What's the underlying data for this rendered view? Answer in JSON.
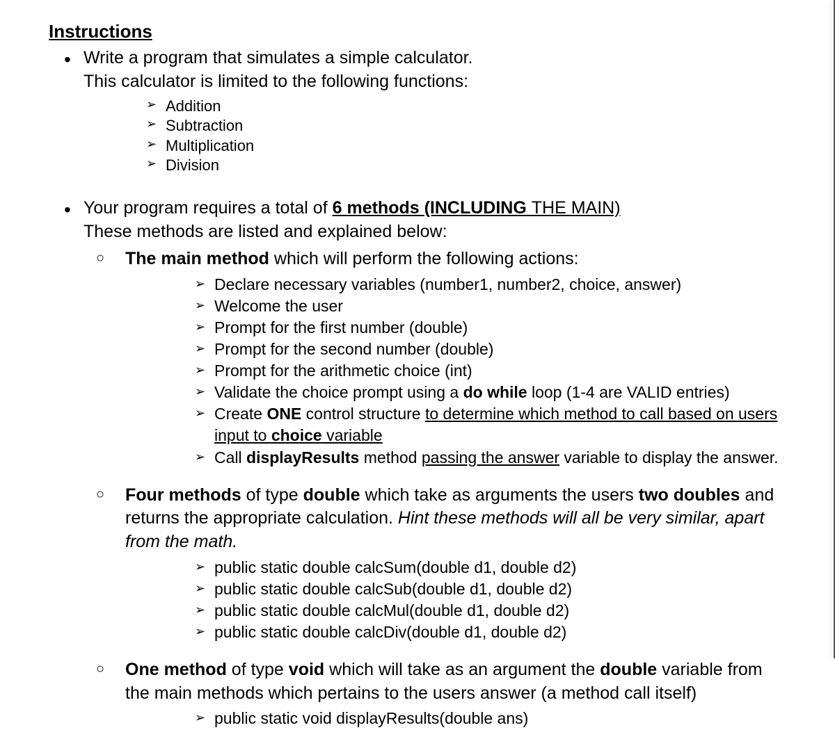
{
  "heading": "Instructions",
  "bullet1": {
    "line1": "Write a program that simulates a simple calculator.",
    "line2": "This calculator is limited to the following functions:",
    "ops": [
      "Addition",
      "Subtraction",
      "Multiplication",
      "Division"
    ]
  },
  "bullet2": {
    "prefix": "Your program requires a total of ",
    "methods_phrase": "6 methods ",
    "including_phrase": "(INCLUDING ",
    "themain": "THE MAIN)",
    "line2": "These methods are listed and explained below:",
    "main_method": {
      "label_bold": "The main method",
      "label_rest": " which will perform the following actions:",
      "actions": {
        "a1": "Declare necessary variables (number1, number2, choice, answer)",
        "a2": "Welcome the user",
        "a3": "Prompt for the first number (double)",
        "a4": "Prompt for the second number (double)",
        "a5": "Prompt for the arithmetic choice (int)",
        "a6_pre": "Validate the choice prompt using a ",
        "a6_bold": "do while",
        "a6_post": " loop (1-4 are VALID entries)",
        "a7_pre": "Create ",
        "a7_bold": "ONE",
        "a7_mid": " control structure ",
        "a7_u1": "to determine which method to call based on users input to ",
        "a7_choice": "choice",
        "a7_u2": " variable",
        "a8_pre": "Call ",
        "a8_bold": "displayResults",
        "a8_mid": " method ",
        "a8_u": "passing the answer",
        "a8_post": " variable to display the answer."
      }
    },
    "four_methods": {
      "t1_bold": "Four methods",
      "t1_mid": " of type ",
      "t1_double": "double",
      "t1_rest": " which take as arguments the users ",
      "t1_two": "two doubles",
      "t2": " and returns the appropriate calculation. ",
      "t2_hint": "Hint these methods will all be very similar, apart from the math.",
      "sigs": [
        "public static double calcSum(double d1, double d2)",
        "public static double calcSub(double d1, double d2)",
        "public static double calcMul(double d1, double d2)",
        "public static double calcDiv(double d1, double d2)"
      ]
    },
    "one_method": {
      "t1_bold": "One method",
      "t1_mid": " of type ",
      "t1_void": "void",
      "t1_rest": " which will take as an argument the ",
      "t1_double": "double",
      "t1_end": " variable from the main methods which pertains to the users answer (a method call itself)",
      "sig": "public static void displayResults(double ans)"
    }
  }
}
